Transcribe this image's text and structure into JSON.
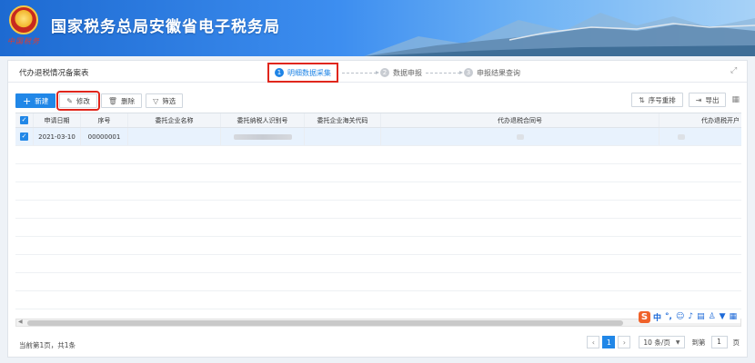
{
  "header": {
    "title": "国家税务总局安徽省电子税务局",
    "emblem_sub": "中国税务"
  },
  "form": {
    "title": "代办退税情况备案表"
  },
  "steps": [
    {
      "num": "1",
      "label": "明细数据采集"
    },
    {
      "num": "2",
      "label": "数据申报"
    },
    {
      "num": "3",
      "label": "申报结果查询"
    }
  ],
  "toolbar": {
    "new_label": "新建",
    "edit_label": "修改",
    "delete_label": "删除",
    "filter_label": "筛选",
    "reorder_label": "序号重排",
    "export_label": "导出"
  },
  "table": {
    "columns": [
      "申请日期",
      "序号",
      "委托企业名称",
      "委托纳税人识别号",
      "委托企业海关代码",
      "代办退税合同号",
      "代办退税开户"
    ],
    "rows": [
      {
        "date": "2021-03-10",
        "seq": "00000001"
      }
    ]
  },
  "ime": {
    "glyph": "中"
  },
  "footer": {
    "page_info": "当前第1页，共1条",
    "current_page": "1",
    "page_size": "10 条/页",
    "goto_label": "到第",
    "goto_value": "1",
    "page_unit": "页"
  },
  "colors": {
    "primary": "#2187e7",
    "highlight": "#e0261c"
  }
}
